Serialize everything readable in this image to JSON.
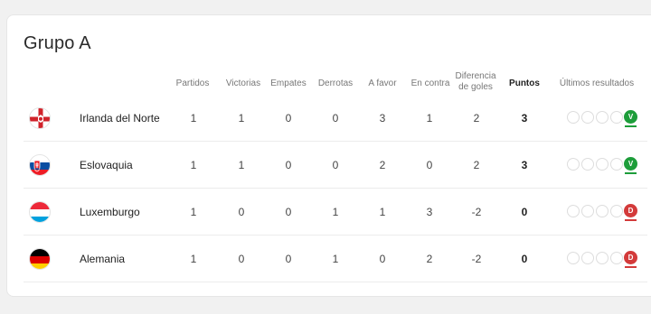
{
  "group": {
    "title": "Grupo A"
  },
  "headers": {
    "played": "Partidos",
    "wins": "Victorias",
    "draws": "Empates",
    "losses": "Derrotas",
    "goals_for": "A favor",
    "goals_against": "En contra",
    "goal_diff_line1": "Diferencia",
    "goal_diff_line2": "de goles",
    "points": "Puntos",
    "last_results": "Últimos resultados"
  },
  "teams": [
    {
      "name": "Irlanda del Norte",
      "flag": "northern-ireland-flag-icon",
      "played": "1",
      "wins": "1",
      "draws": "0",
      "losses": "0",
      "goals_for": "3",
      "goals_against": "1",
      "goal_diff": "2",
      "points": "3",
      "last": "V",
      "last_color": "#1d9d3a"
    },
    {
      "name": "Eslovaquia",
      "flag": "slovakia-flag-icon",
      "played": "1",
      "wins": "1",
      "draws": "0",
      "losses": "0",
      "goals_for": "2",
      "goals_against": "0",
      "goal_diff": "2",
      "points": "3",
      "last": "V",
      "last_color": "#1d9d3a"
    },
    {
      "name": "Luxemburgo",
      "flag": "luxembourg-flag-icon",
      "played": "1",
      "wins": "0",
      "draws": "0",
      "losses": "1",
      "goals_for": "1",
      "goals_against": "3",
      "goal_diff": "-2",
      "points": "0",
      "last": "D",
      "last_color": "#d33a3a"
    },
    {
      "name": "Alemania",
      "flag": "germany-flag-icon",
      "played": "1",
      "wins": "0",
      "draws": "0",
      "losses": "1",
      "goals_for": "0",
      "goals_against": "2",
      "goal_diff": "-2",
      "points": "0",
      "last": "D",
      "last_color": "#d33a3a"
    }
  ]
}
